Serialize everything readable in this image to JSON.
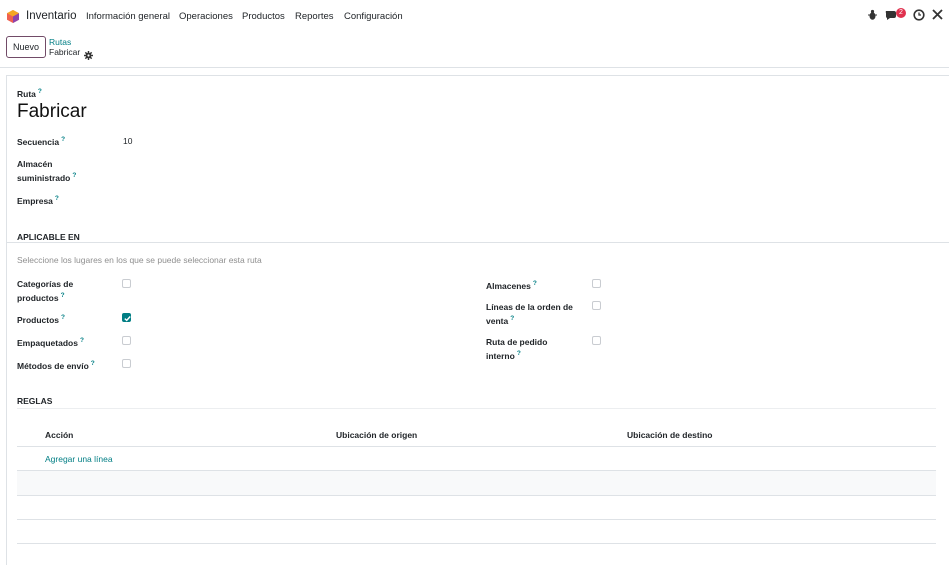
{
  "navbar": {
    "app_name": "Inventario",
    "menu": [
      "Información general",
      "Operaciones",
      "Productos",
      "Reportes",
      "Configuración"
    ],
    "messages_badge": "2",
    "icons": [
      "bug-icon",
      "chat-icon",
      "clock-icon",
      "tools-icon"
    ]
  },
  "control": {
    "new_label": "Nuevo",
    "breadcrumb_parent": "Rutas",
    "breadcrumb_current": "Fabricar"
  },
  "form": {
    "route_label": "Ruta",
    "route_value": "Fabricar",
    "sequence_label": "Secuencia",
    "sequence_value": "10",
    "warehouse_label_1": "Almacén",
    "warehouse_label_2": "suministrado",
    "company_label": "Empresa"
  },
  "applicable": {
    "section_title": "APLICABLE EN",
    "hint": "Seleccione los lugares en los que se puede seleccionar esta ruta",
    "left": [
      {
        "label_1": "Categorías de",
        "label_2": "productos",
        "checked": false
      },
      {
        "label_1": "Productos",
        "label_2": "",
        "checked": true
      },
      {
        "label_1": "Empaquetados",
        "label_2": "",
        "checked": false
      },
      {
        "label_1": "Métodos de envío",
        "label_2": "",
        "checked": false
      }
    ],
    "right": [
      {
        "label_1": "Almacenes",
        "label_2": "",
        "checked": false
      },
      {
        "label_1": "Líneas de la orden de",
        "label_2": "venta",
        "checked": false
      },
      {
        "label_1": "Ruta de pedido",
        "label_2": "interno",
        "checked": false
      }
    ]
  },
  "rules": {
    "section_title": "REGLAS",
    "columns": [
      "Acción",
      "Ubicación de origen",
      "Ubicación de destino"
    ],
    "add_line": "Agregar una línea"
  },
  "colors": {
    "accent": "#017e84",
    "brand": "#714b67",
    "badge": "#e0314e"
  }
}
